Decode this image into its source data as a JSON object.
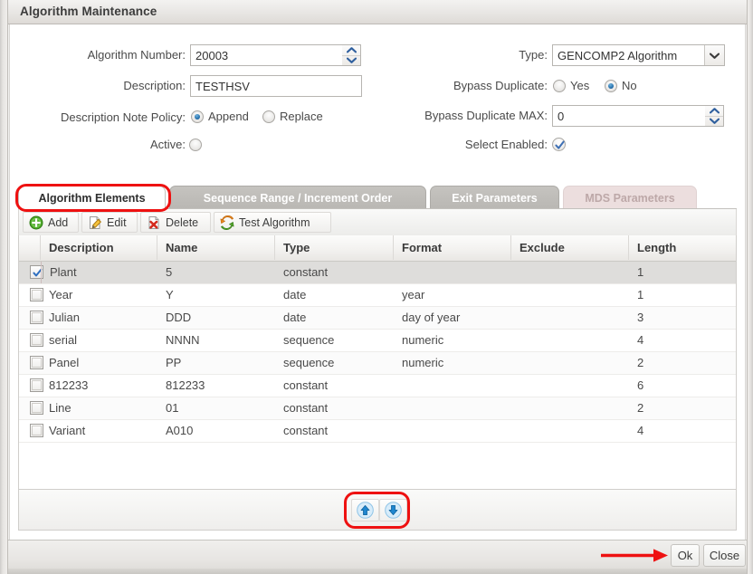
{
  "window": {
    "title": "Algorithm Maintenance"
  },
  "form": {
    "algorithm_number": {
      "label": "Algorithm Number:",
      "value": "20003",
      "spinner_up_icon": "chevron-up-icon",
      "spinner_down_icon": "chevron-down-icon"
    },
    "description": {
      "label": "Description:",
      "value": "TESTHSV"
    },
    "description_note_policy": {
      "label": "Description Note Policy:",
      "options": [
        {
          "label": "Append",
          "selected": true
        },
        {
          "label": "Replace",
          "selected": false
        }
      ]
    },
    "active": {
      "label": "Active:",
      "selected": false
    },
    "type": {
      "label": "Type:",
      "value": "GENCOMP2 Algorithm",
      "arrow_icon": "chevron-down-icon"
    },
    "bypass_duplicate": {
      "label": "Bypass Duplicate:",
      "options": [
        {
          "label": "Yes",
          "selected": false
        },
        {
          "label": "No",
          "selected": true
        }
      ]
    },
    "bypass_duplicate_max": {
      "label": "Bypass Duplicate MAX:",
      "value": "0"
    },
    "select_enabled": {
      "label": "Select Enabled:",
      "checked": true
    }
  },
  "tabs": [
    {
      "label": "Algorithm Elements",
      "state": "active"
    },
    {
      "label": "Sequence Range / Increment Order",
      "state": "inactive"
    },
    {
      "label": "Exit Parameters",
      "state": "inactive"
    },
    {
      "label": "MDS Parameters",
      "state": "disabled"
    }
  ],
  "toolbar": [
    {
      "label": "Add",
      "icon": "add-circle-icon"
    },
    {
      "label": "Edit",
      "icon": "pencil-page-icon"
    },
    {
      "label": "Delete",
      "icon": "delete-page-icon"
    },
    {
      "label": "Test Algorithm",
      "icon": "refresh-arrows-icon"
    }
  ],
  "table": {
    "columns": [
      "Description",
      "Name",
      "Type",
      "Format",
      "Exclude",
      "Length"
    ],
    "rows": [
      {
        "checked": true,
        "description": "Plant",
        "name": "5",
        "type": "constant",
        "format": "",
        "exclude": "",
        "length": "1"
      },
      {
        "checked": false,
        "description": "Year",
        "name": "Y",
        "type": "date",
        "format": "year",
        "exclude": "",
        "length": "1"
      },
      {
        "checked": false,
        "description": "Julian",
        "name": "DDD",
        "type": "date",
        "format": "day of year",
        "exclude": "",
        "length": "3"
      },
      {
        "checked": false,
        "description": "serial",
        "name": "NNNN",
        "type": "sequence",
        "format": "numeric",
        "exclude": "",
        "length": "4"
      },
      {
        "checked": false,
        "description": "Panel",
        "name": "PP",
        "type": "sequence",
        "format": "numeric",
        "exclude": "",
        "length": "2"
      },
      {
        "checked": false,
        "description": "812233",
        "name": "812233",
        "type": "constant",
        "format": "",
        "exclude": "",
        "length": "6"
      },
      {
        "checked": false,
        "description": "Line",
        "name": "01",
        "type": "constant",
        "format": "",
        "exclude": "",
        "length": "2"
      },
      {
        "checked": false,
        "description": "Variant",
        "name": "A010",
        "type": "constant",
        "format": "",
        "exclude": "",
        "length": "4"
      }
    ]
  },
  "move_buttons": [
    {
      "icon": "arrow-up-circle-icon",
      "name": "move-up-button"
    },
    {
      "icon": "arrow-down-circle-icon",
      "name": "move-down-button"
    }
  ],
  "footer": {
    "ok_label": "Ok",
    "close_label": "Close"
  },
  "annotations": {
    "highlight_color": "#ee1111",
    "items": [
      {
        "type": "rounded-rect",
        "target": "tab-algorithm-elements"
      },
      {
        "type": "rounded-rect",
        "target": "move-buttons-group"
      },
      {
        "type": "arrow",
        "target": "ok-button"
      }
    ]
  }
}
